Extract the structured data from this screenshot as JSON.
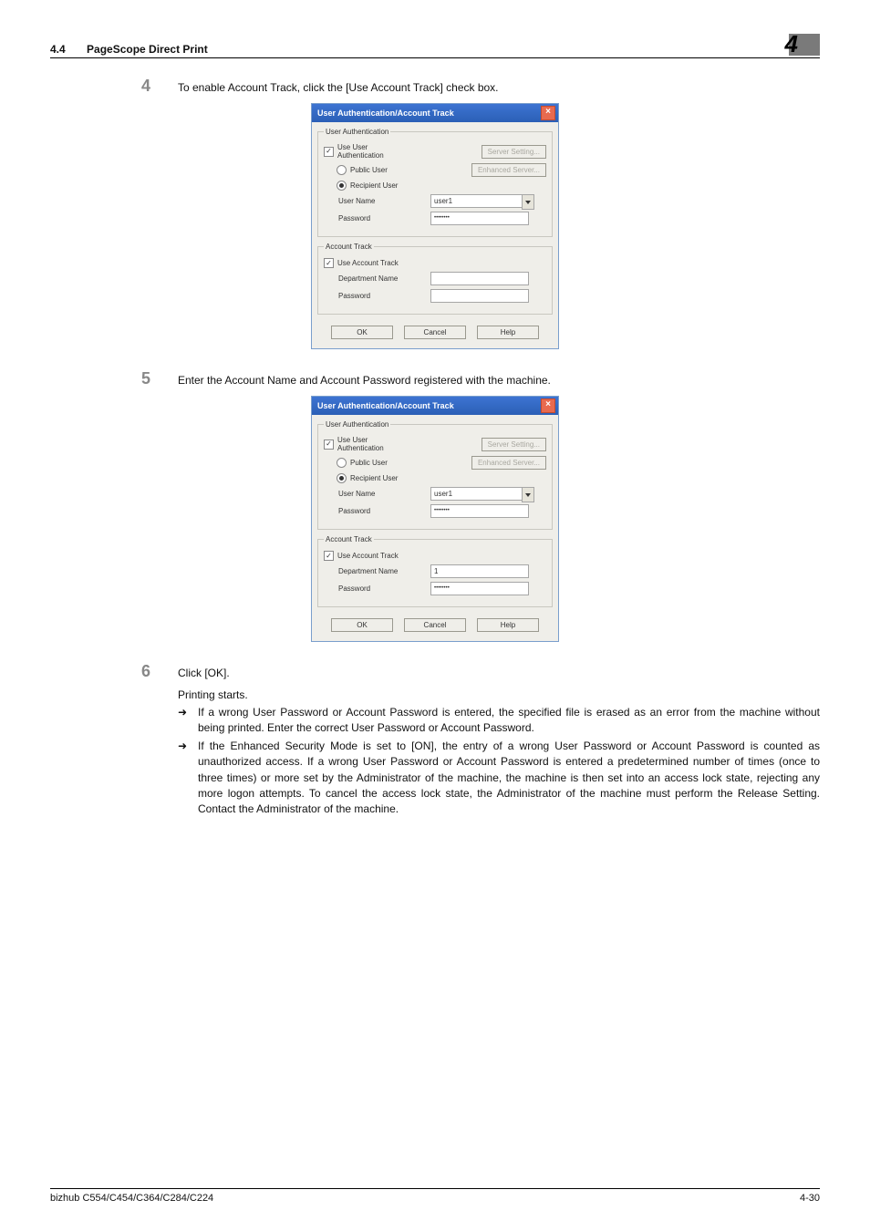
{
  "header": {
    "section_number": "4.4",
    "section_title": "PageScope Direct Print",
    "chapter_number": "4"
  },
  "steps": {
    "s4": {
      "num": "4",
      "text": "To enable Account Track, click the [Use Account Track] check box."
    },
    "s5": {
      "num": "5",
      "text": "Enter the Account Name and Account Password registered with the machine."
    },
    "s6": {
      "num": "6",
      "text": "Click [OK]."
    }
  },
  "after_s6": {
    "line": "Printing starts.",
    "b1": "If a wrong User Password or Account Password is entered, the specified file is erased as an error from the machine without being printed. Enter the correct User Password or Account Password.",
    "b2": "If the Enhanced Security Mode is set to [ON], the entry of a wrong User Password or Account Password is counted as unauthorized access. If a wrong User Password or Account Password is entered a predetermined number of times (once to three times) or more set by the Administrator of the machine, the machine is then set into an access lock state, rejecting any more logon attempts. To cancel the access lock state, the Administrator of the machine must perform the Release Setting. Contact the Administrator of the machine."
  },
  "arrow": "➜",
  "dialog": {
    "title": "User Authentication/Account Track",
    "group_user": "User Authentication",
    "use_user_auth": "Use User Authentication",
    "public_user": "Public User",
    "recipient_user": "Recipient User",
    "user_name_lbl": "User Name",
    "user_name_val": "user1",
    "password_lbl": "Password",
    "password_val": "••••••••",
    "server_setting": "Server Setting...",
    "enhanced_server": "Enhanced Server...",
    "group_acct": "Account Track",
    "use_acct": "Use Account Track",
    "dept_lbl": "Department Name",
    "acct_pass_lbl": "Password",
    "ok": "OK",
    "cancel": "Cancel",
    "help": "Help"
  },
  "dialog2_values": {
    "dept_val": "1",
    "acct_pass_val": "••••••••"
  },
  "footer": {
    "left": "bizhub C554/C454/C364/C284/C224",
    "right": "4-30"
  }
}
